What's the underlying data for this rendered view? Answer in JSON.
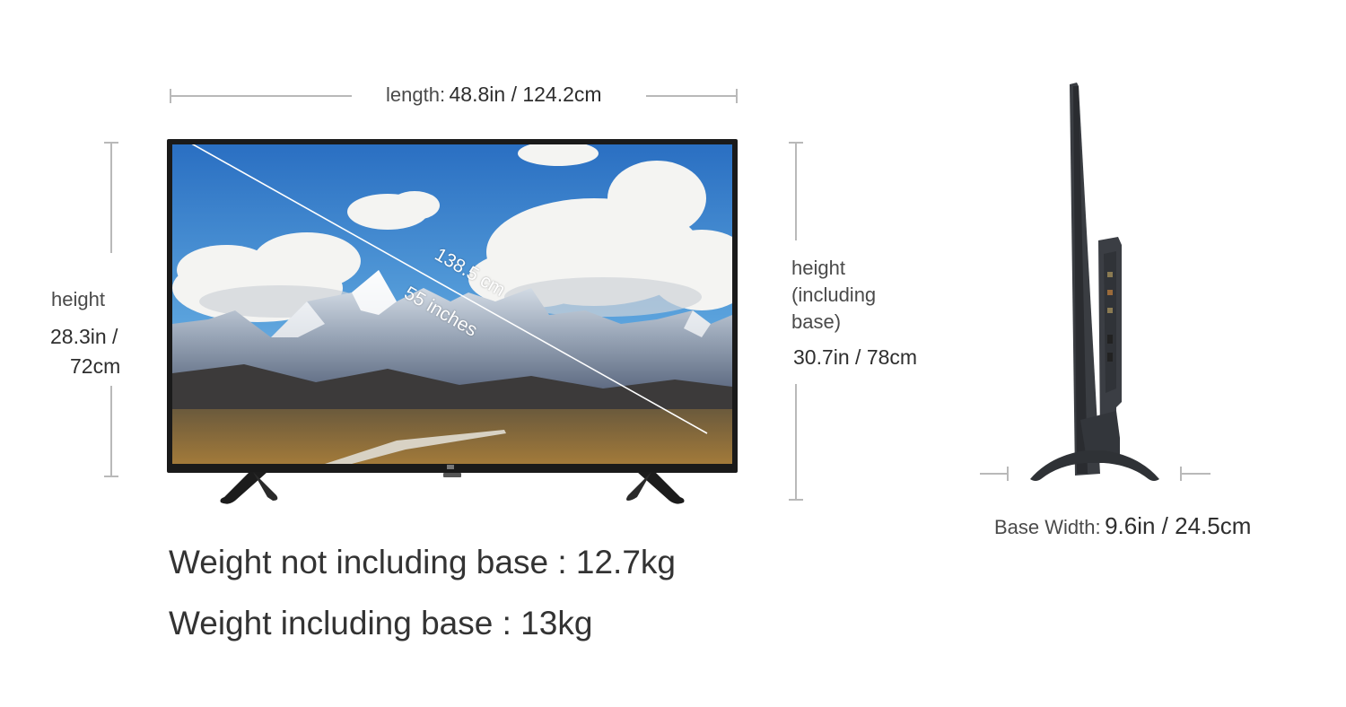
{
  "length": {
    "label": "length:",
    "value": "48.8in / 124.2cm"
  },
  "height_left": {
    "label": "height",
    "value_in": "28.3in /",
    "value_cm": "72cm"
  },
  "height_right": {
    "label_line1": "height",
    "label_line2": "(including",
    "label_line3": "base)",
    "value": "30.7in / 78cm"
  },
  "diagonal": {
    "cm": "138.5 cm",
    "inches": "55 inches"
  },
  "base_width": {
    "label": "Base Width:",
    "value": "9.6in / 24.5cm"
  },
  "weights": {
    "not_including_base": "Weight not including base : 12.7kg",
    "including_base": "Weight including base : 13kg"
  },
  "colors": {
    "dimension_line": "#b9b9b9",
    "tv_bezel": "#1a1a1a",
    "text": "#333333"
  }
}
